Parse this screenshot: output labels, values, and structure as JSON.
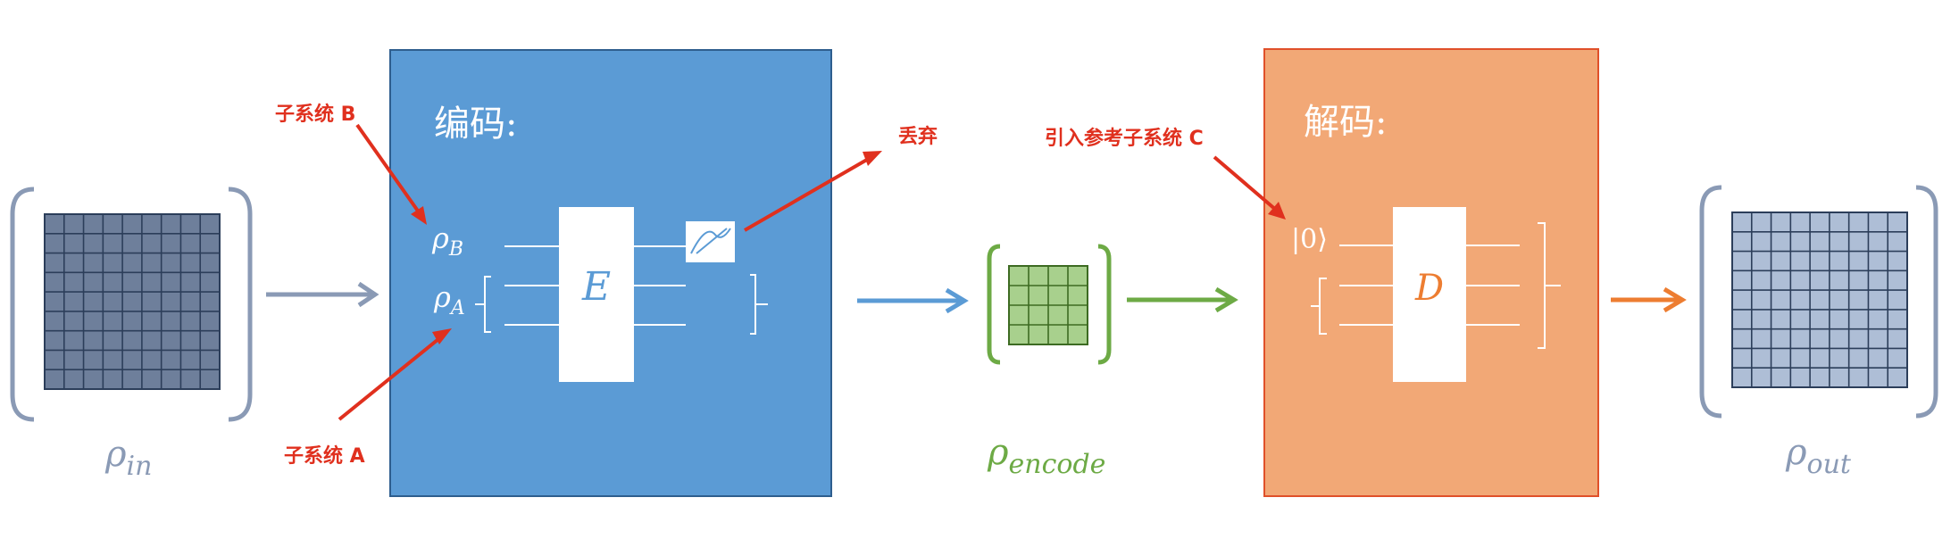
{
  "colors": {
    "encoder_fill": "#5B9BD5",
    "encoder_stroke": "#2E5E8E",
    "decoder_fill": "#F2A876",
    "decoder_stroke": "#E0502A",
    "annotation_red": "#E0301E",
    "input_bracket": "#8A9AB5",
    "input_grid_fill": "#6E7F9B",
    "grid_line": "#2C3E5A",
    "encoded_green": "#6DAA45",
    "encoded_grid_fill": "#A8D08D",
    "output_grid_fill": "#AEBED6",
    "output_arrow": "#ED7D31",
    "white": "#FFFFFF"
  },
  "input": {
    "label_base": "ρ",
    "label_sub": "in"
  },
  "encoder": {
    "title": "编码:",
    "rho_b_base": "ρ",
    "rho_b_sub": "B",
    "rho_a_base": "ρ",
    "rho_a_sub": "A",
    "gate_label": "E",
    "measure_icon": "measurement-icon"
  },
  "annotations": {
    "subsystem_b": "子系统 B",
    "subsystem_a": "子系统 A",
    "discard": "丢弃",
    "introduce_c": "引入参考子系统 C"
  },
  "encoded": {
    "label_base": "ρ",
    "label_sub": "encode"
  },
  "decoder": {
    "title": "解码:",
    "ket_zero": "|0⟩",
    "gate_label": "D"
  },
  "output": {
    "label_base": "ρ",
    "label_sub": "out"
  }
}
